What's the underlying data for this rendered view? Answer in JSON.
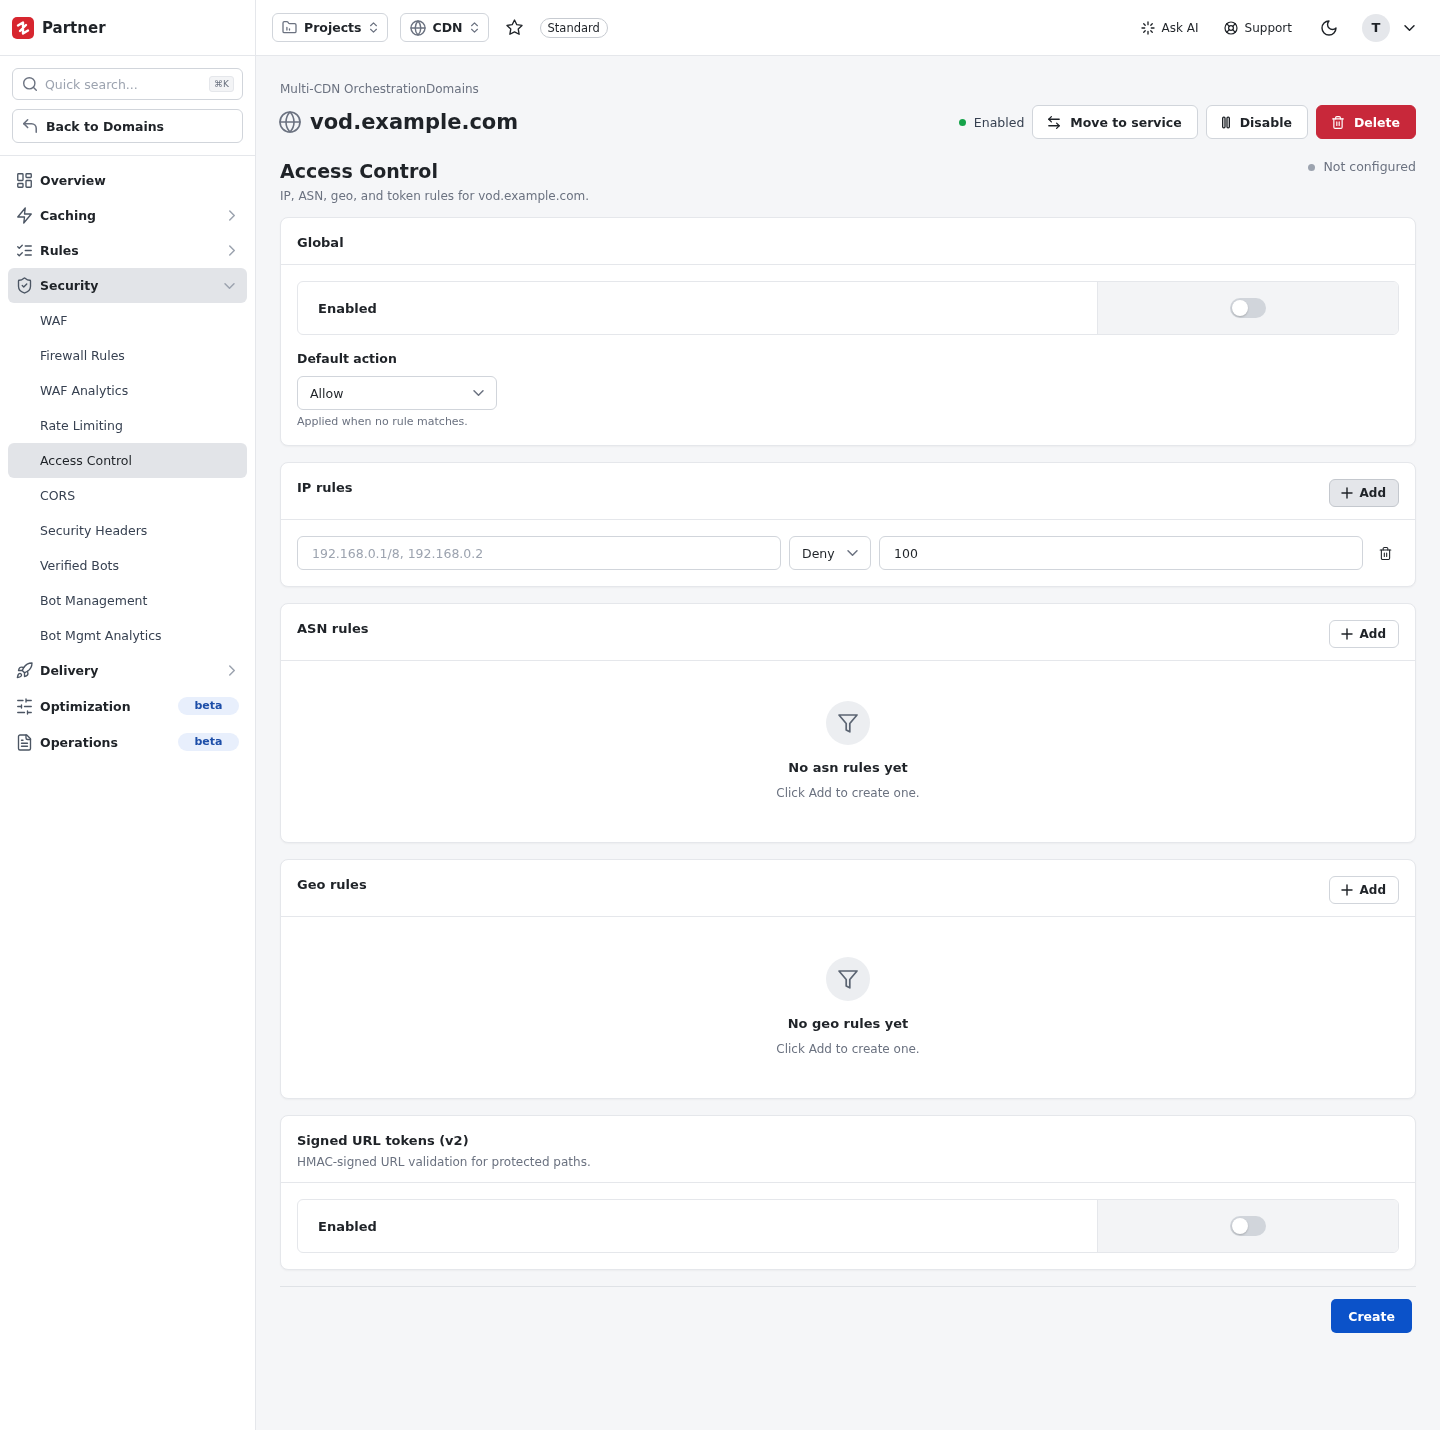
{
  "sidebar": {
    "brand": "Partner",
    "search": {
      "placeholder": "Quick search...",
      "shortcut": "⌘K"
    },
    "back_button": "Back to Domains",
    "nav": [
      {
        "label": "Overview",
        "selected": false
      },
      {
        "label": "Caching",
        "selected": false,
        "expanded": false
      },
      {
        "label": "Rules",
        "selected": false,
        "expanded": false
      },
      {
        "label": "Security",
        "selected": true,
        "expanded": true,
        "children": [
          {
            "label": "WAF",
            "selected": false
          },
          {
            "label": "Firewall Rules",
            "selected": false
          },
          {
            "label": "WAF Analytics",
            "selected": false
          },
          {
            "label": "Rate Limiting",
            "selected": false
          },
          {
            "label": "Access Control",
            "selected": true
          },
          {
            "label": "CORS",
            "selected": false
          },
          {
            "label": "Security Headers",
            "selected": false
          },
          {
            "label": "Verified Bots",
            "selected": false
          },
          {
            "label": "Bot Management",
            "selected": false
          },
          {
            "label": "Bot Mgmt Analytics",
            "selected": false
          }
        ]
      },
      {
        "label": "Delivery",
        "selected": false,
        "expanded": false
      },
      {
        "label": "Optimization",
        "selected": false,
        "badge": "beta"
      },
      {
        "label": "Operations",
        "selected": false,
        "badge": "beta"
      }
    ]
  },
  "topbar": {
    "project_switcher": "Projects",
    "product_switcher": "CDN",
    "starred": false,
    "plan": "Standard",
    "ask_ai": "Ask AI",
    "support": "Support",
    "avatar": "T"
  },
  "header": {
    "breadcrumb": "Multi-CDN OrchestrationDomains",
    "domain": "vod.example.com",
    "status": {
      "label": "Enabled",
      "on": true
    },
    "actions": [
      {
        "label": "Move to service",
        "kind": "move"
      },
      {
        "label": "Disable",
        "kind": "pause"
      },
      {
        "label": "Delete",
        "kind": "danger"
      }
    ]
  },
  "section": {
    "title": "Access Control",
    "description": "IP, ASN, geo, and token rules for vod.example.com.",
    "status": {
      "label": "Not configured",
      "configured": false
    }
  },
  "cards": [
    {
      "kind": "settings",
      "title": "Global",
      "toggle": {
        "label": "Enabled",
        "on": false
      },
      "default_action": {
        "label": "Default action",
        "value": "Allow",
        "help": "Applied when no rule matches."
      }
    },
    {
      "kind": "rules",
      "title": "IP rules",
      "add_button": "Add",
      "hovered": true,
      "rows": [
        {
          "ip_ranges": {
            "placeholder": "192.168.0.1/8, 192.168.0.2"
          },
          "action": "Deny",
          "field_3": {
            "value": "100"
          }
        }
      ]
    },
    {
      "kind": "rules",
      "title": "ASN rules",
      "add_button": "Add",
      "hovered": false,
      "empty_title": "No asn rules yet",
      "empty_hint": "Click Add to create one."
    },
    {
      "kind": "rules",
      "title": "Geo rules",
      "add_button": "Add",
      "hovered": false,
      "empty_title": "No geo rules yet",
      "empty_hint": "Click Add to create one."
    },
    {
      "kind": "settings",
      "title": "Signed URL tokens (v2)",
      "description": "HMAC-signed URL validation for protected paths.",
      "toggle": {
        "label": "Enabled",
        "on": false
      }
    }
  ],
  "footer": {
    "submit": "Create"
  }
}
